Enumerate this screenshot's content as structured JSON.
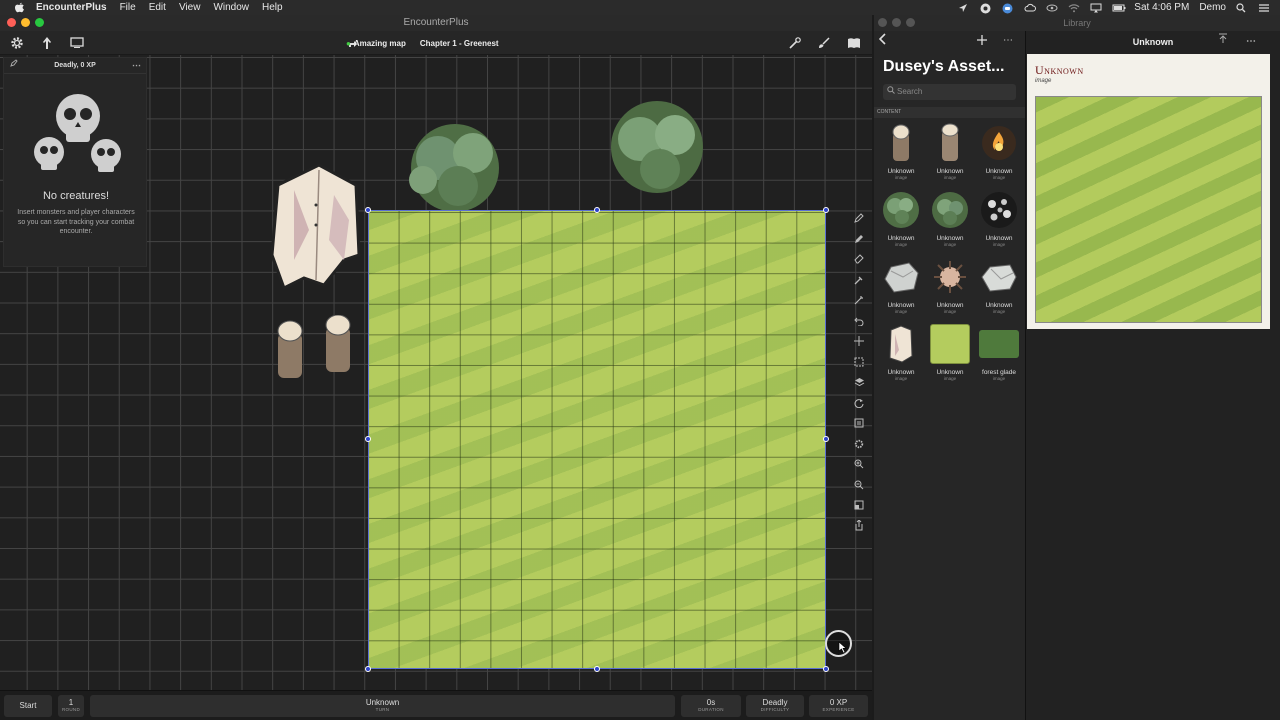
{
  "menubar": {
    "app": "EncounterPlus",
    "items": [
      "File",
      "Edit",
      "View",
      "Window",
      "Help"
    ],
    "clock": "Sat 4:06 PM",
    "user": "Demo"
  },
  "window": {
    "title": "EncounterPlus",
    "toolbar": {
      "map_status": "Amazing map",
      "chapter": "Chapter 1 - Greenest"
    }
  },
  "encounter": {
    "header": "Deadly, 0 XP",
    "more": "⋯",
    "empty_title": "No creatures!",
    "empty_text": "Insert monsters and player characters so you can start tracking your combat encounter."
  },
  "statusbar": {
    "start": "Start",
    "round_value": "1",
    "round_label": "ROUND",
    "turn_value": "Unknown",
    "turn_label": "TURN",
    "duration_value": "0s",
    "duration_label": "DURATION",
    "difficulty_value": "Deadly",
    "difficulty_label": "DIFFICULTY",
    "experience_value": "0 XP",
    "experience_label": "EXPERIENCE"
  },
  "library": {
    "window_title": "Library",
    "collection_title": "Dusey's Asset...",
    "search_placeholder": "Search",
    "section": "CONTENT",
    "items": [
      {
        "name": "Unknown",
        "type": "image",
        "kind": "pillar"
      },
      {
        "name": "Unknown",
        "type": "image",
        "kind": "pillar"
      },
      {
        "name": "Unknown",
        "type": "image",
        "kind": "fire"
      },
      {
        "name": "Unknown",
        "type": "image",
        "kind": "bush"
      },
      {
        "name": "Unknown",
        "type": "image",
        "kind": "bush"
      },
      {
        "name": "Unknown",
        "type": "image",
        "kind": "rocks"
      },
      {
        "name": "Unknown",
        "type": "image",
        "kind": "rock"
      },
      {
        "name": "Unknown",
        "type": "image",
        "kind": "spike"
      },
      {
        "name": "Unknown",
        "type": "image",
        "kind": "rock"
      },
      {
        "name": "Unknown",
        "type": "image",
        "kind": "cloth"
      },
      {
        "name": "Unknown",
        "type": "image",
        "kind": "grass"
      },
      {
        "name": "forest glade",
        "type": "image",
        "kind": "glade"
      }
    ],
    "detail": {
      "header": "Unknown",
      "title": "Unknown",
      "subtitle": "image"
    }
  }
}
